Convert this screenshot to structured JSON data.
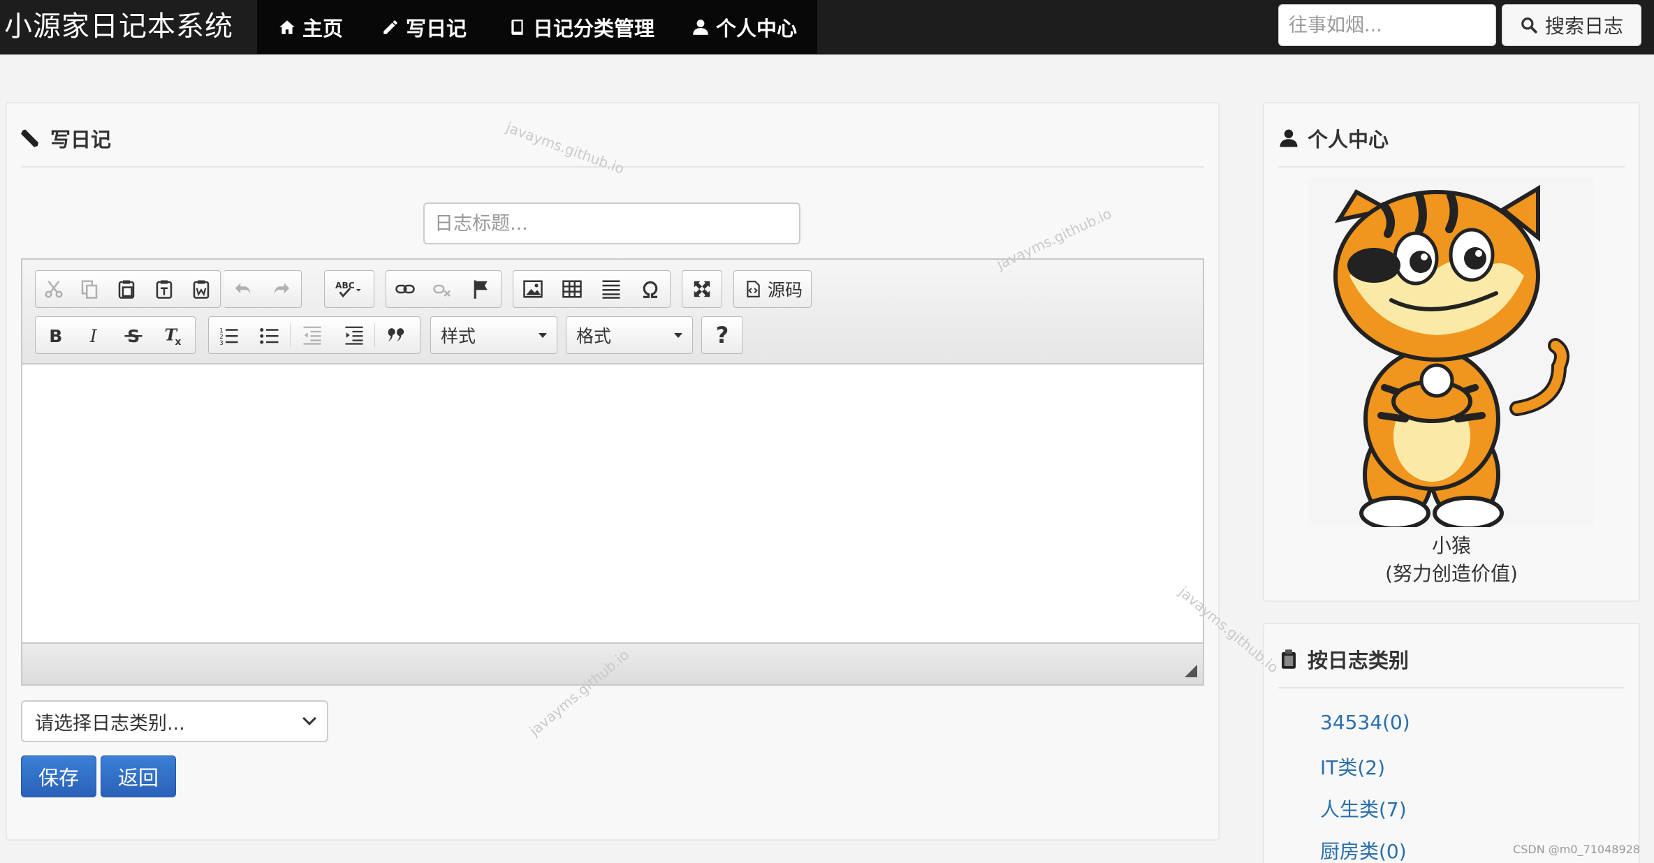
{
  "navbar": {
    "brand": "小源家日记本系统",
    "items": [
      {
        "label": "主页",
        "icon": "home-icon"
      },
      {
        "label": "写日记",
        "icon": "pencil-icon"
      },
      {
        "label": "日记分类管理",
        "icon": "book-icon"
      },
      {
        "label": "个人中心",
        "icon": "user-icon"
      }
    ],
    "search_placeholder": "往事如烟...",
    "search_button": "搜索日志"
  },
  "write_panel": {
    "title": "写日记",
    "title_placeholder": "日志标题...",
    "toolbar": {
      "source_label": "源码",
      "style_label": "样式",
      "format_label": "格式",
      "help_label": "?"
    },
    "category_select": "请选择日志类别...",
    "save_label": "保存",
    "back_label": "返回"
  },
  "profile_panel": {
    "title": "个人中心",
    "name": "小猿",
    "motto": "(努力创造价值)"
  },
  "category_panel": {
    "title": "按日志类别",
    "items": [
      "34534(0)",
      "IT类(2)",
      "人生类(7)",
      "厨房类(0)"
    ]
  },
  "watermark_text": "javayms.github.io",
  "footer_note": "CSDN @m0_71048928"
}
